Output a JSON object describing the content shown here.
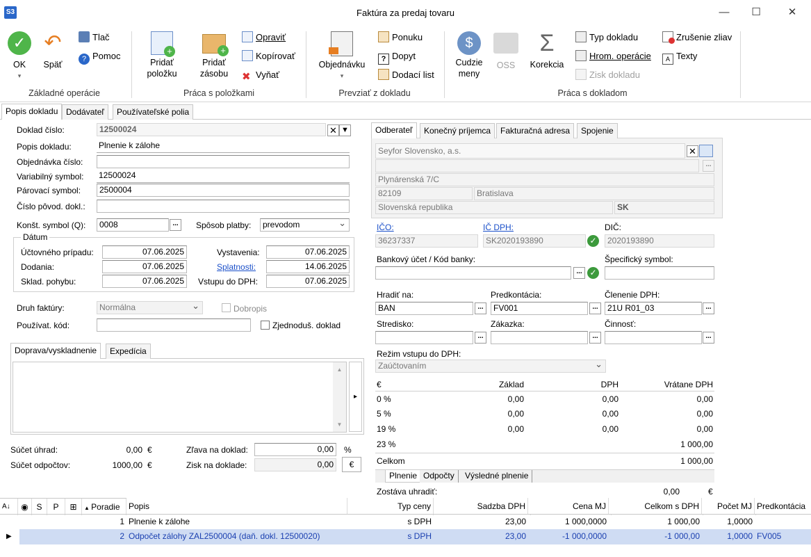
{
  "window": {
    "app_logo": "S3",
    "title": "Faktúra za predaj tovaru",
    "minimize": "—",
    "maximize": "☐",
    "close": "✕"
  },
  "ribbon": {
    "ok": "OK",
    "back": "Späť",
    "print": "Tlač",
    "help": "Pomoc",
    "group_basic": "Základné operácie",
    "add_item": "Pridať\npoložku",
    "add_stock": "Pridať\nzásobu",
    "edit": "Opraviť",
    "copy": "Kopírovať",
    "cut": "Vyňať",
    "group_items": "Práca s položkami",
    "orders": "Objednávku",
    "offers": "Ponuku",
    "inquiry": "Dopyt",
    "delivery_note": "Dodací list",
    "group_take": "Prevziať z dokladu",
    "foreign": "Cudzie\nmeny",
    "oss": "OSS",
    "correction": "Korekcia",
    "doc_type": "Typ dokladu",
    "bulk_ops": "Hrom. operácie",
    "profit": "Zisk dokladu",
    "cancel_discount": "Zrušenie zliav",
    "texts": "Texty",
    "group_doc": "Práca s dokladom"
  },
  "main_tabs": [
    "Popis dokladu",
    "Dodávateľ",
    "Používateľské polia"
  ],
  "form": {
    "doc_number_label": "Doklad číslo:",
    "doc_number": "12500024",
    "description_label": "Popis dokladu:",
    "description": "Plnenie k zálohe",
    "order_label": "Objednávka číslo:",
    "order": "",
    "varsym_label": "Variabilný symbol:",
    "varsym": "12500024",
    "pairsym_label": "Párovací symbol:",
    "pairsym": "2500004",
    "origdoc_label": "Číslo pôvod. dokl.:",
    "origdoc": "",
    "constsym_label": "Konšt. symbol (Q):",
    "constsym": "0008",
    "payment_label": "Spôsob platby:",
    "payment": "prevodom",
    "date_legend": "Dátum",
    "acc_case_label": "Účtovného prípadu:",
    "acc_case": "07.06.2025",
    "delivery_label": "Dodania:",
    "delivery": "07.06.2025",
    "stock_label": "Sklad. pohybu:",
    "stock": "07.06.2025",
    "issued_label": "Vystavenia:",
    "issued": "07.06.2025",
    "due_label": "Splatnosti:",
    "due": "14.06.2025",
    "vat_entry_label": "Vstupu do DPH:",
    "vat_entry": "07.06.2025",
    "inv_type_label": "Druh faktúry:",
    "inv_type": "Normálna",
    "credit_note": "Dobropis",
    "user_code_label": "Používat. kód:",
    "user_code": "",
    "simplified": "Zjednoduš. doklad"
  },
  "subtabs": [
    "Doprava/vyskladnenie",
    "Expedícia"
  ],
  "totals_left": {
    "paid_label": "Súčet úhrad:",
    "paid": "0,00",
    "paid_cur": "€",
    "deduct_label": "Súčet odpočtov:",
    "deduct": "1000,00",
    "deduct_cur": "€",
    "discount_label": "Zľava na doklad:",
    "discount": "0,00",
    "discount_unit": "%",
    "profit_label": "Zisk na doklade:",
    "profit": "0,00",
    "profit_btn": "€"
  },
  "partner_tabs": [
    "Odberateľ",
    "Konečný príjemca",
    "Fakturačná adresa",
    "Spojenie"
  ],
  "partner": {
    "name": "Seyfor Slovensko, a.s.",
    "street": "Plynárenská 7/C",
    "zip": "82109",
    "city": "Bratislava",
    "country": "Slovenská republika",
    "country_code": "SK",
    "ico_label": "IČO:",
    "ico": "36237337",
    "icdph_label": "IČ DPH:",
    "icdph": "SK2020193890",
    "dic_label": "DIČ:",
    "dic": "2020193890",
    "bank_label": "Bankový účet / Kód banky:",
    "bank": "",
    "specsym_label": "Špecifický symbol:",
    "specsym": ""
  },
  "right": {
    "pay_to_label": "Hradiť na:",
    "pay_to": "BAN",
    "precont_label": "Predkontácia:",
    "precont": "FV001",
    "vat_split_label": "Členenie DPH:",
    "vat_split": "21U R01_03",
    "center_label": "Stredisko:",
    "center": "",
    "contract_label": "Zákazka:",
    "contract": "",
    "activity_label": "Činnosť:",
    "activity": "",
    "vat_mode_label": "Režim vstupu do DPH:",
    "vat_mode": "Zaúčtovaním"
  },
  "vat_table": {
    "headers": [
      "€",
      "Základ",
      "DPH",
      "Vrátane DPH"
    ],
    "rows": [
      [
        "0 %",
        "0,00",
        "0,00",
        "0,00"
      ],
      [
        "5 %",
        "0,00",
        "0,00",
        "0,00"
      ],
      [
        "19 %",
        "0,00",
        "0,00",
        "0,00"
      ],
      [
        "23 %",
        "",
        "",
        "1 000,00"
      ]
    ],
    "total_label": "Celkom",
    "total": "1 000,00",
    "tabs": [
      "Plnenie",
      "Odpočty",
      "Výsledné plnenie"
    ],
    "balance_label": "Zostáva uhradiť:",
    "balance": "0,00",
    "balance_cur": "€"
  },
  "grid": {
    "headers": [
      "S",
      "P",
      "Poradie",
      "Popis",
      "Typ ceny",
      "Sadzba DPH",
      "Cena MJ",
      "Celkom s DPH",
      "Počet MJ",
      "Predkontácia"
    ],
    "rows": [
      {
        "order": "1",
        "desc": "Plnenie k zálohe",
        "price_type": "s DPH",
        "vat": "23,00",
        "unit_price": "1 000,0000",
        "total": "1 000,00",
        "qty": "1,0000",
        "precont": ""
      },
      {
        "order": "2",
        "desc": "Odpočet zálohy ZAL2500004 (daň. dokl. 12500020)",
        "price_type": "s DPH",
        "vat": "23,00",
        "unit_price": "-1 000,0000",
        "total": "-1 000,00",
        "qty": "1,0000",
        "precont": "FV005"
      }
    ]
  }
}
